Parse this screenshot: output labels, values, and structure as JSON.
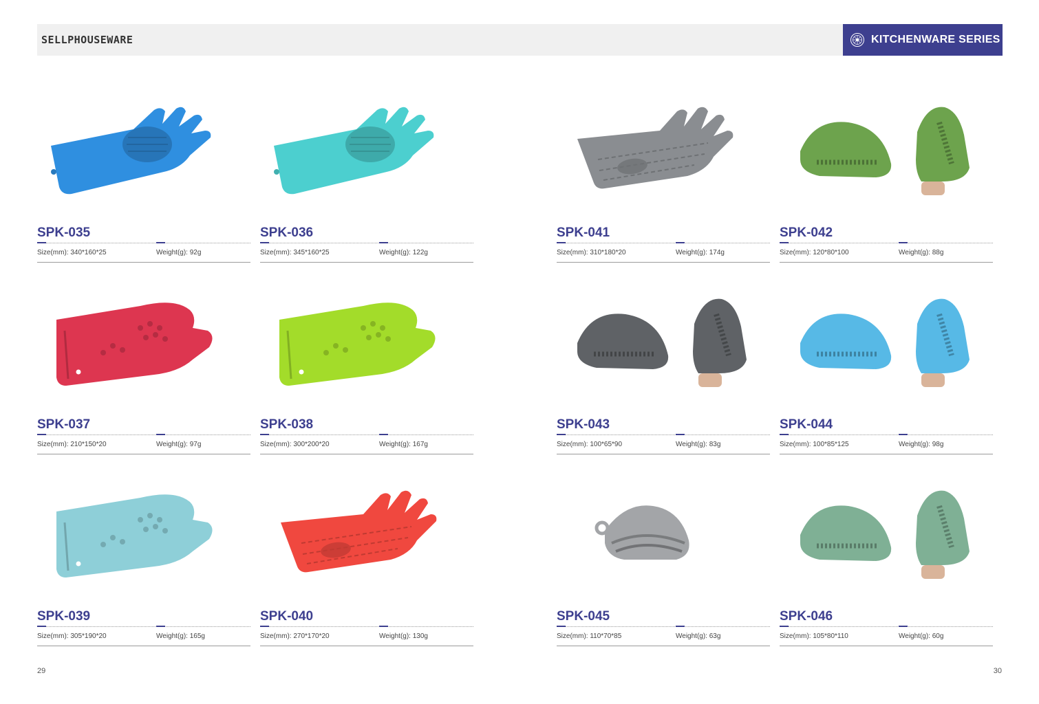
{
  "header": {
    "brand": "SELLPHOUSEWARE",
    "series_title": "KITCHENWARE SERIES",
    "series_icon": "globe-seal-icon",
    "accent": "#3d3f8f"
  },
  "products": [
    {
      "code": "SPK-035",
      "size": "Size(mm): 340*160*25",
      "weight": "Weight(g): 92g",
      "color": "#2f8fe0",
      "kind": "glove-brush"
    },
    {
      "code": "SPK-036",
      "size": "Size(mm): 345*160*25",
      "weight": "Weight(g): 122g",
      "color": "#4ccfcf",
      "kind": "glove-brush"
    },
    {
      "code": "SPK-041",
      "size": "Size(mm): 310*180*20",
      "weight": "Weight(g): 174g",
      "color": "#8a8d91",
      "kind": "glove"
    },
    {
      "code": "SPK-042",
      "size": "Size(mm): 120*80*100",
      "weight": "Weight(g): 88g",
      "color": "#6da34d",
      "kind": "pinch-pair"
    },
    {
      "code": "SPK-037",
      "size": "Size(mm): 210*150*20",
      "weight": "Weight(g): 97g",
      "color": "#dd3650",
      "kind": "mitt"
    },
    {
      "code": "SPK-038",
      "size": "Size(mm): 300*200*20",
      "weight": "Weight(g): 167g",
      "color": "#a3dc2a",
      "kind": "mitt"
    },
    {
      "code": "SPK-043",
      "size": "Size(mm): 100*65*90",
      "weight": "Weight(g): 83g",
      "color": "#5f6266",
      "kind": "pinch-pair"
    },
    {
      "code": "SPK-044",
      "size": "Size(mm): 100*85*125",
      "weight": "Weight(g): 98g",
      "color": "#57b9e6",
      "kind": "pinch-pair"
    },
    {
      "code": "SPK-039",
      "size": "Size(mm): 305*190*20",
      "weight": "Weight(g): 165g",
      "color": "#8ecfd8",
      "kind": "mitt"
    },
    {
      "code": "SPK-040",
      "size": "Size(mm): 270*170*20",
      "weight": "Weight(g): 130g",
      "color": "#f0483f",
      "kind": "glove"
    },
    {
      "code": "SPK-045",
      "size": "Size(mm): 110*70*85",
      "weight": "Weight(g): 63g",
      "color": "#a3a5a8",
      "kind": "pinch"
    },
    {
      "code": "SPK-046",
      "size": "Size(mm): 105*80*110",
      "weight": "Weight(g): 60g",
      "color": "#7fb095",
      "kind": "pinch-pair"
    }
  ],
  "page_left": "29",
  "page_right": "30"
}
